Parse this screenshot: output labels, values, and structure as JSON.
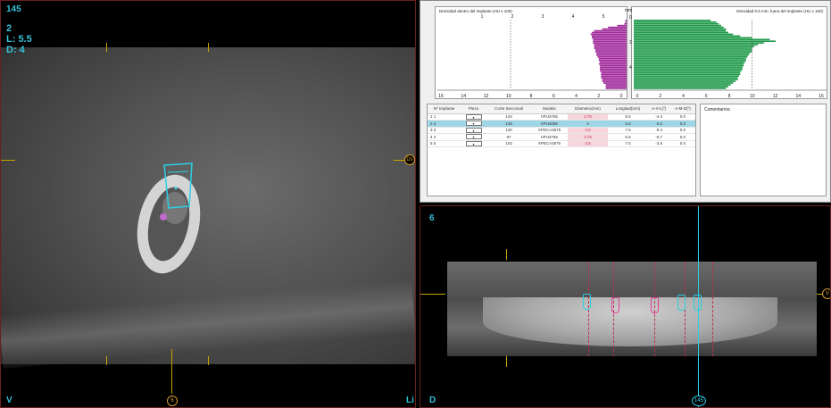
{
  "left_view": {
    "slice_number": "145",
    "implant_number": "2",
    "length_label": "L: 5.5",
    "diameter_label": "D: 4",
    "corner_left": "V",
    "corner_right": "Li",
    "right_marker": "Ds",
    "bottom_marker": "6"
  },
  "graphs": {
    "left_title": "Densidad dentro del Implante (HU x 100)",
    "right_title": "Densidad 0.5 mm. fuera del Implante (HU x 100)",
    "left_top_ticks": [
      "1",
      "2",
      "3",
      "4",
      "5"
    ],
    "left_bottom_ticks": [
      "16",
      "14",
      "12",
      "10",
      "8",
      "6",
      "4",
      "2",
      "0"
    ],
    "right_bottom_ticks": [
      "0",
      "2",
      "4",
      "6",
      "8",
      "10",
      "12",
      "14",
      "16"
    ],
    "mm_label": "mm",
    "mm_ticks": [
      "0",
      "2",
      "4"
    ],
    "left_color": "#a0289a",
    "right_color": "#1f9a4a",
    "left_values": [
      0.1,
      0.1,
      0.2,
      0.8,
      1.6,
      2.1,
      2.8,
      3.0,
      3.1,
      3.0,
      3.0,
      2.9,
      2.9,
      2.9,
      2.8,
      2.8,
      2.8,
      2.7,
      2.7,
      2.6,
      2.6,
      2.5,
      2.4,
      2.4,
      2.3,
      2.4,
      2.3,
      2.3,
      2.3,
      2.3,
      2.2,
      2.2,
      2.2,
      2.2,
      2.1,
      2.1,
      2.0,
      1.8,
      1.8,
      1.8
    ],
    "right_values": [
      6.5,
      7.0,
      7.2,
      7.4,
      7.6,
      7.8,
      7.8,
      8.0,
      8.4,
      9.0,
      10.0,
      11.5,
      12.0,
      11.0,
      10.5,
      10.2,
      10.0,
      10.0,
      10.0,
      9.8,
      9.7,
      9.6,
      9.5,
      9.5,
      9.4,
      9.3,
      9.3,
      9.2,
      9.2,
      9.1,
      9.0,
      9.0,
      8.9,
      8.8,
      8.8,
      8.6,
      8.4,
      8.2,
      8.0,
      7.8
    ]
  },
  "table": {
    "headers": [
      "Nº Implante",
      "Pieza",
      "Corte Seccional",
      "Modelo",
      "Diámetro(mm)",
      "Longitud(mm)",
      "A-V-L(º)",
      "A-M-D(º)"
    ],
    "rows": [
      {
        "idx": "1",
        "implant": "1",
        "slice": "134",
        "model": "IIPU3755",
        "diameter": "3.75",
        "length": "5.5",
        "avl": "-4.4",
        "amd": "0.0"
      },
      {
        "idx": "2",
        "implant": "2",
        "slice": "145",
        "model": "IIPU4055",
        "diameter": "4",
        "length": "5.5",
        "avl": "-5.2",
        "amd": "0.0"
      },
      {
        "idx": "3",
        "implant": "3",
        "slice": "120",
        "model": "XPECA3575",
        "diameter": "3.5",
        "length": "7.5",
        "avl": "-5.4",
        "amd": "0.0"
      },
      {
        "idx": "4",
        "implant": "4",
        "slice": "97",
        "model": "IIPU3755",
        "diameter": "3.75",
        "length": "5.5",
        "avl": "-5.7",
        "amd": "0.0"
      },
      {
        "idx": "5",
        "implant": "5",
        "slice": "102",
        "model": "XPECA3575",
        "diameter": "3.5",
        "length": "7.5",
        "avl": "-3.5",
        "amd": "0.0"
      }
    ],
    "comments_label": "Comentarios:"
  },
  "bottom_view": {
    "slice_number": "6",
    "corner_left": "D",
    "right_marker": "V",
    "bottom_marker": "145"
  }
}
